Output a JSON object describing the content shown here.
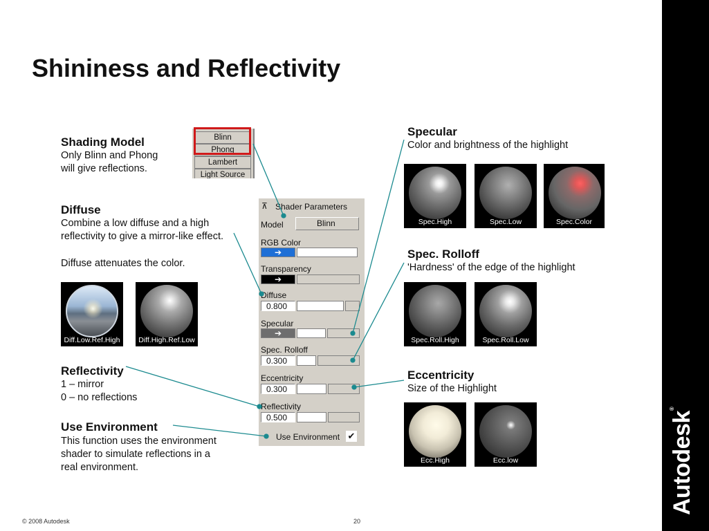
{
  "slide": {
    "title": "Shininess and Reflectivity",
    "footer_copyright": "© 2008 Autodesk",
    "page_number": "20",
    "brand": "Autodesk"
  },
  "shading_model": {
    "heading": "Shading Model",
    "desc_line1": "Only Blinn and Phong",
    "desc_line2": "will give reflections.",
    "list_items": [
      "Blinn",
      "Phong",
      "Lambert",
      "Light Source"
    ]
  },
  "diffuse": {
    "heading": "Diffuse",
    "desc_line1": "Combine a low diffuse and a high",
    "desc_line2": "reflectivity to give a mirror-like effect.",
    "note": "Diffuse attenuates the color.",
    "thumbs": [
      "Diff.Low.Ref.High",
      "Diff.High.Ref.Low"
    ]
  },
  "reflectivity": {
    "heading": "Reflectivity",
    "line1": "1 – mirror",
    "line2": "0 – no reflections"
  },
  "use_environment": {
    "heading": "Use Environment",
    "line1": "This function uses the environment",
    "line2": "shader to simulate reflections in a",
    "line3": "real environment."
  },
  "specular": {
    "heading": "Specular",
    "desc": "Color and brightness of the highlight",
    "thumbs": [
      "Spec.High",
      "Spec.Low",
      "Spec.Color"
    ]
  },
  "spec_rolloff": {
    "heading": "Spec. Rolloff",
    "desc": "'Hardness' of the edge of the highlight",
    "thumbs": [
      "Spec.Roll.High",
      "Spec.Roll.Low"
    ]
  },
  "eccentricity": {
    "heading": "Eccentricity",
    "desc": "Size of the Highlight",
    "thumbs": [
      "Ecc.High",
      "Ecc.low"
    ]
  },
  "panel": {
    "title": "Shader Parameters",
    "model_label": "Model",
    "model_value": "Blinn",
    "rgb_color_label": "RGB Color",
    "transparency_label": "Transparency",
    "diffuse_label": "Diffuse",
    "diffuse_value": "0.800",
    "specular_label": "Specular",
    "rolloff_label": "Spec. Rolloff",
    "rolloff_value": "0.300",
    "eccentricity_label": "Eccentricity",
    "eccentricity_value": "0.300",
    "reflectivity_label": "Reflectivity",
    "reflectivity_value": "0.500",
    "use_env_label": "Use Environment",
    "use_env_checked": true,
    "rgb_swatch_color": "#1e6fd6",
    "transparency_swatch_color": "#000000",
    "specular_swatch_color": "#6e6e6e"
  },
  "colors": {
    "highlight_box": "#d0191a",
    "leader_line": "#1b8a8f"
  }
}
